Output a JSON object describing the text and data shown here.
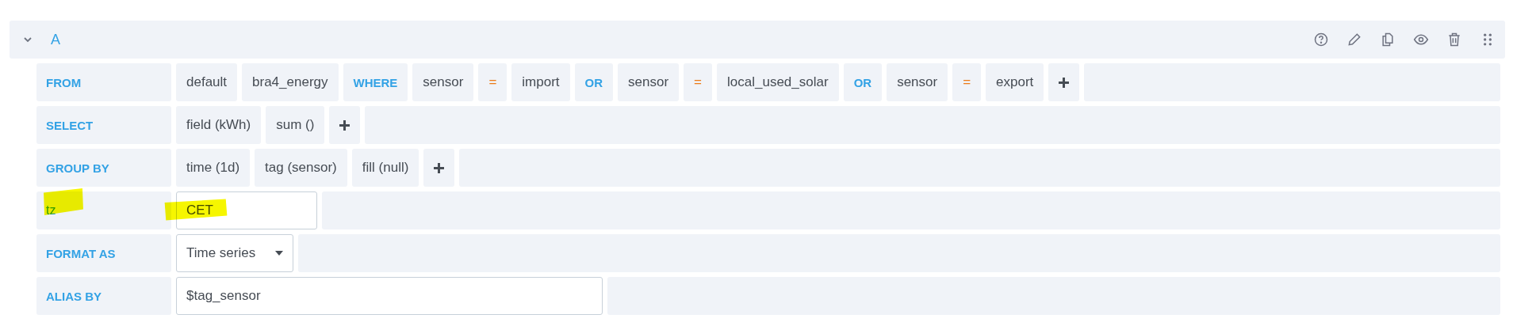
{
  "query": {
    "name": "A",
    "expanded": true
  },
  "rows": [
    {
      "label": "FROM",
      "label_highlighted": false,
      "kind": "segments",
      "segments": [
        {
          "kind": "value",
          "text": "default"
        },
        {
          "kind": "value",
          "text": "bra4_energy"
        },
        {
          "kind": "keyword",
          "text": "WHERE"
        },
        {
          "kind": "value",
          "text": "sensor"
        },
        {
          "kind": "operator",
          "text": "="
        },
        {
          "kind": "value",
          "text": "import"
        },
        {
          "kind": "keyword",
          "text": "OR"
        },
        {
          "kind": "value",
          "text": "sensor"
        },
        {
          "kind": "operator",
          "text": "="
        },
        {
          "kind": "value",
          "text": "local_used_solar"
        },
        {
          "kind": "keyword",
          "text": "OR"
        },
        {
          "kind": "value",
          "text": "sensor"
        },
        {
          "kind": "operator",
          "text": "="
        },
        {
          "kind": "value",
          "text": "export"
        },
        {
          "kind": "add"
        }
      ]
    },
    {
      "label": "SELECT",
      "label_highlighted": false,
      "kind": "segments",
      "segments": [
        {
          "kind": "value",
          "text": "field (kWh)"
        },
        {
          "kind": "value",
          "text": "sum ()"
        },
        {
          "kind": "add"
        }
      ]
    },
    {
      "label": "GROUP BY",
      "label_highlighted": false,
      "kind": "segments",
      "segments": [
        {
          "kind": "value",
          "text": "time (1d)"
        },
        {
          "kind": "value",
          "text": "tag (sensor)"
        },
        {
          "kind": "value",
          "text": "fill (null)"
        },
        {
          "kind": "add"
        }
      ]
    },
    {
      "label": "tz",
      "label_highlighted": true,
      "kind": "input",
      "value": "CET",
      "highlighted": true
    },
    {
      "label": "FORMAT AS",
      "label_highlighted": false,
      "kind": "select",
      "value": "Time series"
    },
    {
      "label": "ALIAS BY",
      "label_highlighted": false,
      "kind": "wide_input",
      "value": "$tag_sensor",
      "highlighted": false
    }
  ]
}
